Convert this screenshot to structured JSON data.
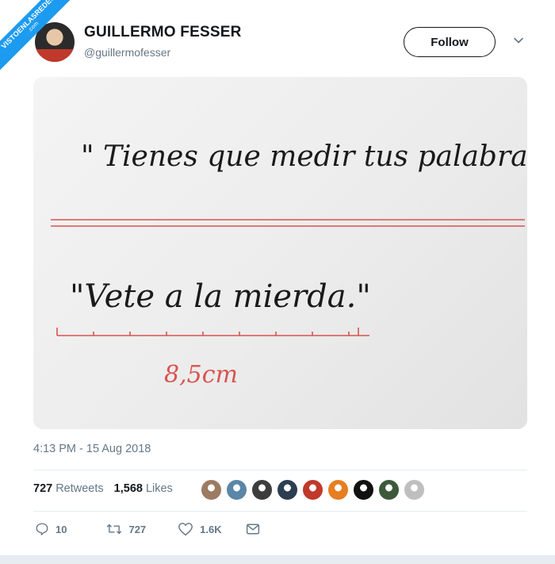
{
  "watermark": {
    "text": "VISTOENLASREDES",
    "domain": ".com"
  },
  "tweet": {
    "author_name": "GUILLERMO FESSER",
    "author_handle": "@guillermofesser",
    "follow_label": "Follow",
    "image": {
      "line1": "\" Tienes que medir tus palabras ... \"",
      "line2": "\"Vete a la mierda.\"",
      "measure": "8,5cm"
    },
    "timestamp": "4:13 PM - 15 Aug 2018",
    "stats": {
      "retweets_count": "727",
      "retweets_label": "Retweets",
      "likes_count": "1,568",
      "likes_label": "Likes"
    },
    "actions": {
      "reply_count": "10",
      "retweet_count": "727",
      "like_count": "1.6K"
    }
  },
  "liker_avatar_colors": [
    "#9c7b62",
    "#5b86a8",
    "#3d3d3d",
    "#2c3e50",
    "#c0392b",
    "#e67e22",
    "#111111",
    "#3c5a3a",
    "#bfbfbf"
  ],
  "colors": {
    "accent": "#1d9bf0",
    "muted": "#657786",
    "ruler": "#d9534f"
  }
}
